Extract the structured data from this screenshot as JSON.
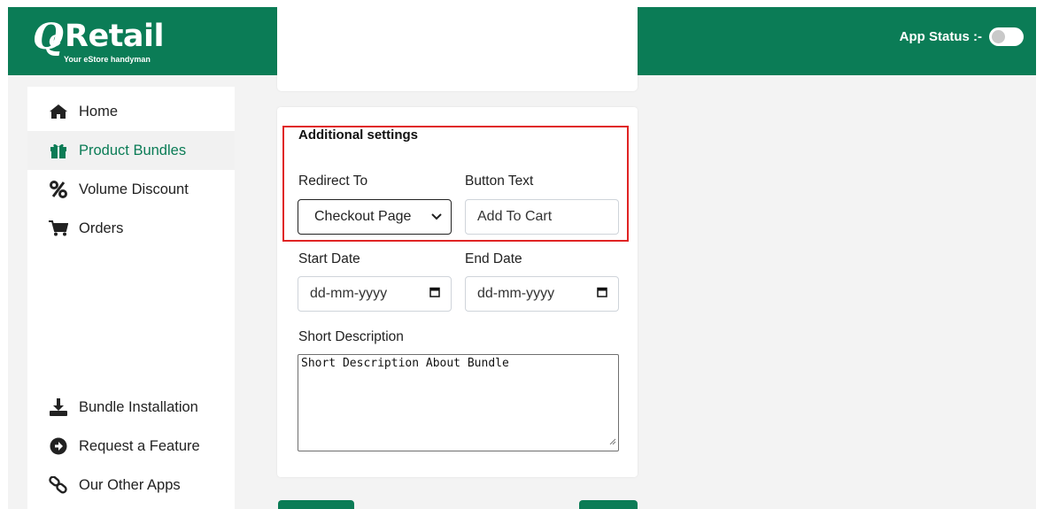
{
  "header": {
    "logo": {
      "name": "eRetail",
      "tagline": "Your eStore handyman"
    },
    "app_status_label": "App Status :-",
    "app_status_on": false
  },
  "colors": {
    "brand": "#0b7c56",
    "highlight": "#e02424",
    "sidebar_active": "#f1f1f1"
  },
  "sidebar": {
    "items": [
      {
        "label": "Home",
        "icon": "home-icon",
        "active": false
      },
      {
        "label": "Product Bundles",
        "icon": "gift-icon",
        "active": true
      },
      {
        "label": "Volume Discount",
        "icon": "percent-icon",
        "active": false
      },
      {
        "label": "Orders",
        "icon": "cart-icon",
        "active": false
      }
    ],
    "bottom_items": [
      {
        "label": "Bundle Installation",
        "icon": "download-icon"
      },
      {
        "label": "Request a Feature",
        "icon": "arrow-circle-right-icon"
      },
      {
        "label": "Our Other Apps",
        "icon": "link-icon"
      }
    ]
  },
  "form": {
    "section_title": "Additional settings",
    "redirect_label": "Redirect To",
    "redirect_value": "Checkout Page",
    "button_text_label": "Button Text",
    "button_text_value": "Add To Cart",
    "start_date_label": "Start Date",
    "start_date_placeholder": "dd-mm-yyyy",
    "end_date_label": "End Date",
    "end_date_placeholder": "dd-mm-yyyy",
    "short_description_label": "Short Description",
    "short_description_value": "Short Description About Bundle"
  }
}
